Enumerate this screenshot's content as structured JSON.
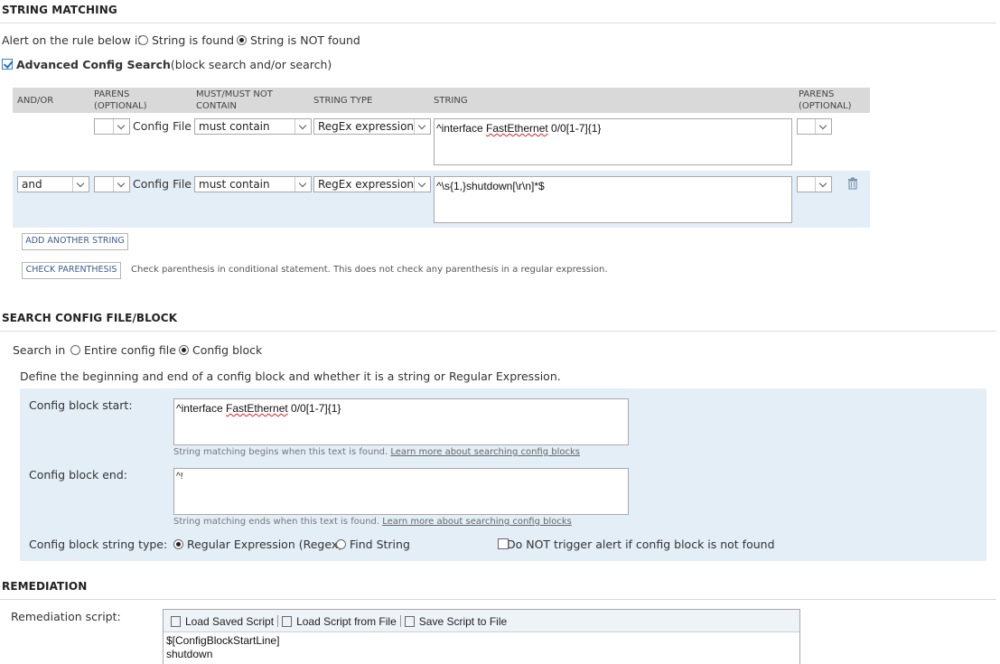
{
  "string_matching": {
    "title": "STRING MATCHING",
    "alert_label": "Alert on the rule below if",
    "alert_options": [
      "String is found",
      "String is NOT found"
    ],
    "alert_selected": "String is NOT found",
    "advanced_label": "Advanced Config Search",
    "advanced_suffix": "(block search and/or search)",
    "advanced_checked": true,
    "headers": {
      "andor": "AND/OR",
      "parens": "PARENS\n(OPTIONAL)",
      "must": "MUST/MUST NOT\nCONTAIN",
      "string_type": "STRING TYPE",
      "string": "STRING",
      "parens2": "PARENS\n(OPTIONAL)"
    },
    "rows": [
      {
        "andor": "",
        "paren_open": "",
        "source": "Config File",
        "must": "must contain",
        "type": "RegEx expression",
        "string_pre": "^interface ",
        "string_spell": "FastEthernet",
        "string_post": " 0/0[1-7]{1}",
        "paren_close": ""
      },
      {
        "andor": "and",
        "paren_open": "",
        "source": "Config File",
        "must": "must contain",
        "type": "RegEx expression",
        "string_pre": "^\\s{1,}shutdown[\\r\\n]*$",
        "string_spell": "",
        "string_post": "",
        "paren_close": ""
      }
    ],
    "add_button": "ADD ANOTHER STRING",
    "check_button": "CHECK PARENTHESIS",
    "check_note": "Check parenthesis in conditional statement. This does not check any parenthesis in a regular expression."
  },
  "search_config": {
    "title": "SEARCH CONFIG FILE/BLOCK",
    "search_in_label": "Search in",
    "options": [
      "Entire config file",
      "Config block"
    ],
    "selected": "Config block",
    "define_text": "Define the beginning and end of a config block and whether it is a string or Regular Expression.",
    "start_label": "Config block start:",
    "start_pre": "^interface ",
    "start_spell": "FastEthernet",
    "start_post": " 0/0[1-7]{1}",
    "start_hint": "String matching begins when this text is found.",
    "end_label": "Config block end:",
    "end_value": "^!",
    "end_hint": "String matching ends when this text is found.",
    "learn_more": "Learn more about searching config blocks",
    "type_label": "Config block string type:",
    "type_options": [
      "Regular Expression (Regex)",
      "Find String"
    ],
    "type_selected": "Regular Expression (Regex)",
    "no_trigger_label": "Do NOT trigger alert if config block is not found",
    "no_trigger_checked": false
  },
  "remediation": {
    "title": "REMEDIATION",
    "script_label": "Remediation script:",
    "toolbar": [
      "Load Saved Script",
      "Load Script from File",
      "Save Script to File"
    ],
    "script_lines": [
      "$[ConfigBlockStartLine]",
      "shutdown"
    ]
  },
  "colors": {
    "panel": "#e3eef7",
    "header_bar": "#d9d9d9",
    "link": "#3a5e8c"
  }
}
